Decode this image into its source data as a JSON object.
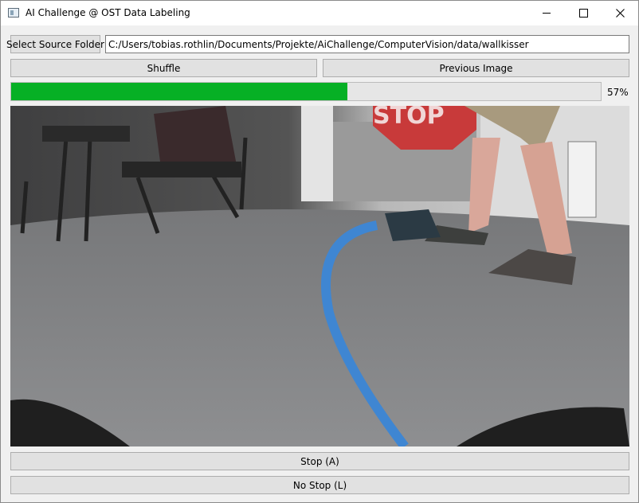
{
  "window": {
    "title": "AI Challenge @ OST Data Labeling",
    "icon": "app-window-icon"
  },
  "toolbar": {
    "select_folder_label": "Select Source Folder",
    "folder_path": "C:/Users/tobias.rothlin/Documents/Projekte/AiChallenge/ComputerVision/data/wallkisser",
    "shuffle_label": "Shuffle",
    "previous_label": "Previous Image"
  },
  "progress": {
    "value": 0.57,
    "label": "57%",
    "color": "#06b025"
  },
  "image": {
    "description_icon": "camera-frame-image",
    "sign_text": "STOP"
  },
  "labels": {
    "stop_label": "Stop (A)",
    "no_stop_label": "No Stop (L)"
  }
}
